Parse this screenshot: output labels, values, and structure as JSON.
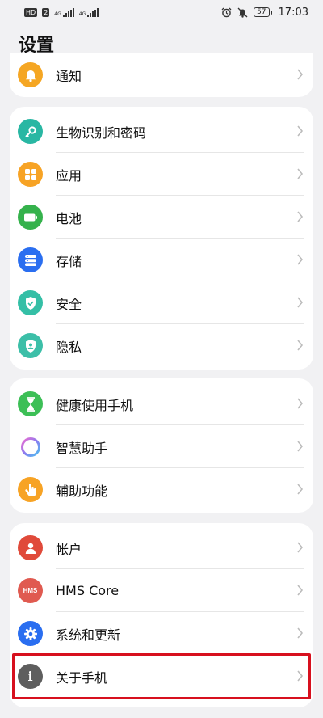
{
  "statusbar": {
    "left_chip": "HD",
    "left_chip2": "2",
    "net1": "4G",
    "net2": "4G",
    "battery": "57",
    "time": "17:03"
  },
  "page": {
    "title": "设置"
  },
  "colors": {
    "notify": "#f5a623",
    "bio": "#29b7a3",
    "apps": "#f7a325",
    "battery": "#35b24c",
    "storage": "#2a6ef0",
    "security": "#34bfa6",
    "privacy": "#3cbfa8",
    "health": "#3cbf56",
    "assistant": "#9a7df0",
    "accessibility": "#f7a325",
    "account": "#e04a3a",
    "hms": "#e05a50",
    "system": "#2a6ef0",
    "about": "#5e5e5e",
    "highlight": "#d7101e"
  },
  "groups": [
    {
      "items": [
        {
          "label": "通知",
          "icon": "bell-icon"
        }
      ]
    },
    {
      "items": [
        {
          "label": "生物识别和密码",
          "icon": "key-icon"
        },
        {
          "label": "应用",
          "icon": "apps-grid-icon"
        },
        {
          "label": "电池",
          "icon": "battery-icon"
        },
        {
          "label": "存储",
          "icon": "storage-icon"
        },
        {
          "label": "安全",
          "icon": "shield-icon"
        },
        {
          "label": "隐私",
          "icon": "privacy-icon"
        }
      ]
    },
    {
      "items": [
        {
          "label": "健康使用手机",
          "icon": "hourglass-icon"
        },
        {
          "label": "智慧助手",
          "icon": "assistant-ring-icon"
        },
        {
          "label": "辅助功能",
          "icon": "hand-icon"
        }
      ]
    },
    {
      "items": [
        {
          "label": "帐户",
          "icon": "user-icon"
        },
        {
          "label": "HMS Core",
          "icon": "hms-icon",
          "icon_text": "HMS"
        },
        {
          "label": "系统和更新",
          "icon": "gear-icon"
        },
        {
          "label": "关于手机",
          "icon": "info-icon",
          "icon_text": "i"
        }
      ]
    }
  ]
}
